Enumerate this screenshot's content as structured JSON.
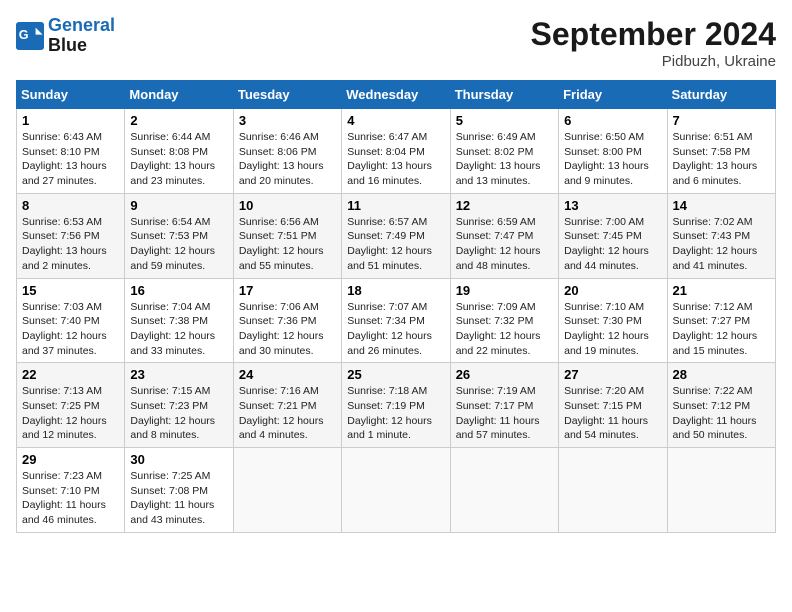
{
  "logo": {
    "line1": "General",
    "line2": "Blue"
  },
  "title": "September 2024",
  "location": "Pidbuzh, Ukraine",
  "days_header": [
    "Sunday",
    "Monday",
    "Tuesday",
    "Wednesday",
    "Thursday",
    "Friday",
    "Saturday"
  ],
  "weeks": [
    [
      {
        "day": "1",
        "sunrise": "6:43 AM",
        "sunset": "8:10 PM",
        "daylight": "Daylight: 13 hours and 27 minutes."
      },
      {
        "day": "2",
        "sunrise": "6:44 AM",
        "sunset": "8:08 PM",
        "daylight": "Daylight: 13 hours and 23 minutes."
      },
      {
        "day": "3",
        "sunrise": "6:46 AM",
        "sunset": "8:06 PM",
        "daylight": "Daylight: 13 hours and 20 minutes."
      },
      {
        "day": "4",
        "sunrise": "6:47 AM",
        "sunset": "8:04 PM",
        "daylight": "Daylight: 13 hours and 16 minutes."
      },
      {
        "day": "5",
        "sunrise": "6:49 AM",
        "sunset": "8:02 PM",
        "daylight": "Daylight: 13 hours and 13 minutes."
      },
      {
        "day": "6",
        "sunrise": "6:50 AM",
        "sunset": "8:00 PM",
        "daylight": "Daylight: 13 hours and 9 minutes."
      },
      {
        "day": "7",
        "sunrise": "6:51 AM",
        "sunset": "7:58 PM",
        "daylight": "Daylight: 13 hours and 6 minutes."
      }
    ],
    [
      {
        "day": "8",
        "sunrise": "6:53 AM",
        "sunset": "7:56 PM",
        "daylight": "Daylight: 13 hours and 2 minutes."
      },
      {
        "day": "9",
        "sunrise": "6:54 AM",
        "sunset": "7:53 PM",
        "daylight": "Daylight: 12 hours and 59 minutes."
      },
      {
        "day": "10",
        "sunrise": "6:56 AM",
        "sunset": "7:51 PM",
        "daylight": "Daylight: 12 hours and 55 minutes."
      },
      {
        "day": "11",
        "sunrise": "6:57 AM",
        "sunset": "7:49 PM",
        "daylight": "Daylight: 12 hours and 51 minutes."
      },
      {
        "day": "12",
        "sunrise": "6:59 AM",
        "sunset": "7:47 PM",
        "daylight": "Daylight: 12 hours and 48 minutes."
      },
      {
        "day": "13",
        "sunrise": "7:00 AM",
        "sunset": "7:45 PM",
        "daylight": "Daylight: 12 hours and 44 minutes."
      },
      {
        "day": "14",
        "sunrise": "7:02 AM",
        "sunset": "7:43 PM",
        "daylight": "Daylight: 12 hours and 41 minutes."
      }
    ],
    [
      {
        "day": "15",
        "sunrise": "7:03 AM",
        "sunset": "7:40 PM",
        "daylight": "Daylight: 12 hours and 37 minutes."
      },
      {
        "day": "16",
        "sunrise": "7:04 AM",
        "sunset": "7:38 PM",
        "daylight": "Daylight: 12 hours and 33 minutes."
      },
      {
        "day": "17",
        "sunrise": "7:06 AM",
        "sunset": "7:36 PM",
        "daylight": "Daylight: 12 hours and 30 minutes."
      },
      {
        "day": "18",
        "sunrise": "7:07 AM",
        "sunset": "7:34 PM",
        "daylight": "Daylight: 12 hours and 26 minutes."
      },
      {
        "day": "19",
        "sunrise": "7:09 AM",
        "sunset": "7:32 PM",
        "daylight": "Daylight: 12 hours and 22 minutes."
      },
      {
        "day": "20",
        "sunrise": "7:10 AM",
        "sunset": "7:30 PM",
        "daylight": "Daylight: 12 hours and 19 minutes."
      },
      {
        "day": "21",
        "sunrise": "7:12 AM",
        "sunset": "7:27 PM",
        "daylight": "Daylight: 12 hours and 15 minutes."
      }
    ],
    [
      {
        "day": "22",
        "sunrise": "7:13 AM",
        "sunset": "7:25 PM",
        "daylight": "Daylight: 12 hours and 12 minutes."
      },
      {
        "day": "23",
        "sunrise": "7:15 AM",
        "sunset": "7:23 PM",
        "daylight": "Daylight: 12 hours and 8 minutes."
      },
      {
        "day": "24",
        "sunrise": "7:16 AM",
        "sunset": "7:21 PM",
        "daylight": "Daylight: 12 hours and 4 minutes."
      },
      {
        "day": "25",
        "sunrise": "7:18 AM",
        "sunset": "7:19 PM",
        "daylight": "Daylight: 12 hours and 1 minute."
      },
      {
        "day": "26",
        "sunrise": "7:19 AM",
        "sunset": "7:17 PM",
        "daylight": "Daylight: 11 hours and 57 minutes."
      },
      {
        "day": "27",
        "sunrise": "7:20 AM",
        "sunset": "7:15 PM",
        "daylight": "Daylight: 11 hours and 54 minutes."
      },
      {
        "day": "28",
        "sunrise": "7:22 AM",
        "sunset": "7:12 PM",
        "daylight": "Daylight: 11 hours and 50 minutes."
      }
    ],
    [
      {
        "day": "29",
        "sunrise": "7:23 AM",
        "sunset": "7:10 PM",
        "daylight": "Daylight: 11 hours and 46 minutes."
      },
      {
        "day": "30",
        "sunrise": "7:25 AM",
        "sunset": "7:08 PM",
        "daylight": "Daylight: 11 hours and 43 minutes."
      },
      null,
      null,
      null,
      null,
      null
    ]
  ]
}
